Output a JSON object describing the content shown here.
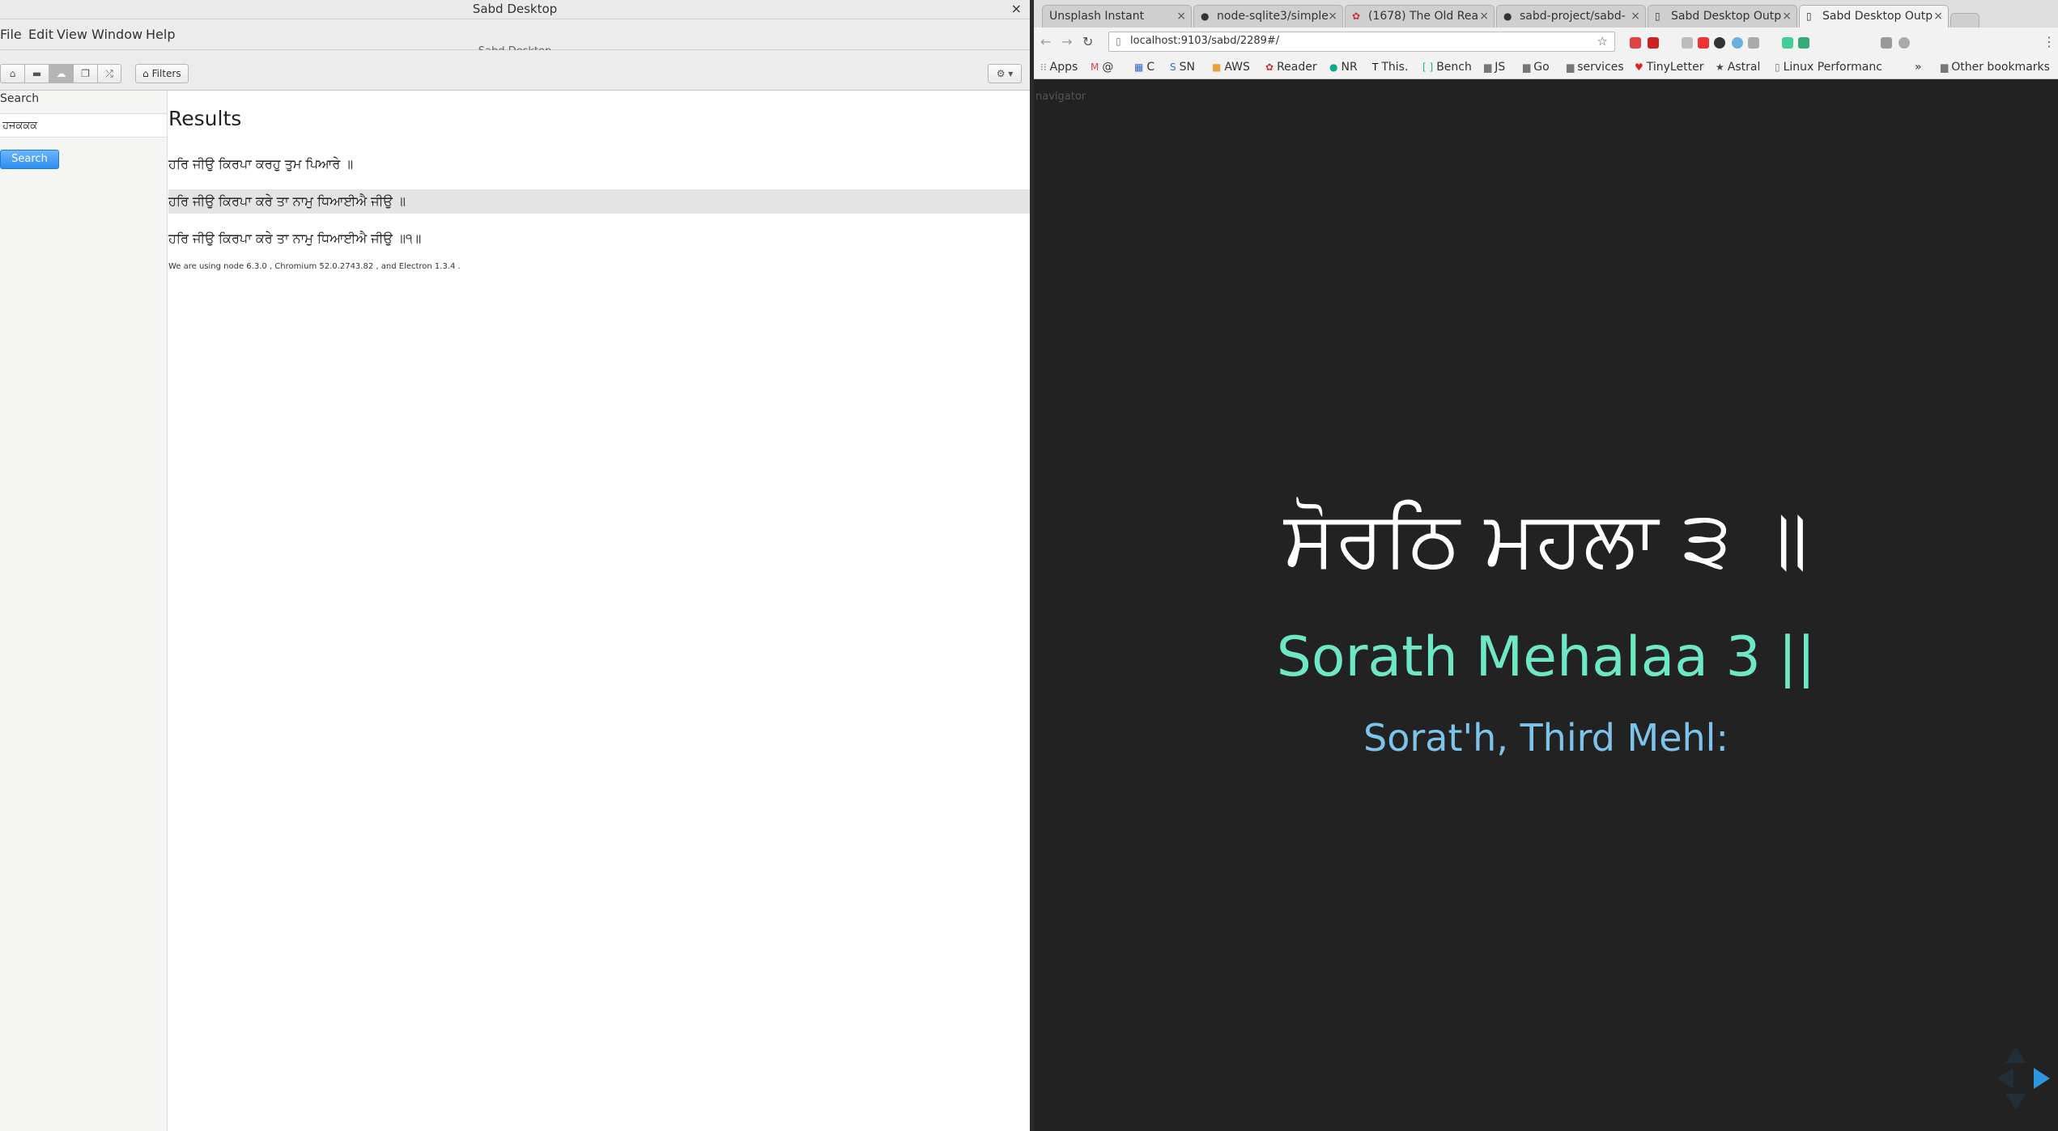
{
  "electron": {
    "title": "Sabd Desktop",
    "close": "×",
    "menu": [
      "File",
      "Edit",
      "View",
      "Window",
      "Help"
    ],
    "subtitle": "Sabd Desktop",
    "toolbar": {
      "filters_label": "Filters",
      "dropdown_label": "⚙ ▾"
    },
    "sidebar": {
      "search_label": "Search",
      "search_value": "ਹਜਕਕਕ",
      "search_button": "Search"
    },
    "results": {
      "heading": "Results",
      "items": [
        "ਹਰਿ ਜੀਉ ਕਿਰਪਾ ਕਰਹੁ ਤੁਮ ਪਿਆਰੇ ॥",
        "ਹਰਿ ਜੀਉ ਕਿਰਪਾ ਕਰੇ ਤਾ ਨਾਮੁ ਧਿਆਈਐ ਜੀਉ ॥",
        "ਹਰਿ ਜੀਉ ਕਿਰਪਾ ਕਰੇ ਤਾ ਨਾਮੁ ਧਿਆਈਐ ਜੀਉ ॥੧॥"
      ],
      "selected_index": 1,
      "footer": "We are using node 6.3.0 , Chromium 52.0.2743.82 , and Electron 1.3.4 ."
    }
  },
  "browser": {
    "tabs": [
      "Unsplash Instant",
      "node-sqlite3/simple",
      "(1678) The Old Rea",
      "sabd-project/sabd-",
      "Sabd Desktop Outp",
      "Sabd Desktop Outp"
    ],
    "active_tab": 5,
    "tab_close": "×",
    "url": "localhost:9103/sabd/2289#/",
    "bookmarks": [
      "Apps",
      "@",
      "C",
      "SN",
      "AWS",
      "Reader",
      "NR",
      "This.",
      "Bench",
      "JS",
      "Go",
      "services",
      "TinyLetter",
      "Astral",
      "Linux Performanc",
      "»",
      "Other bookmarks"
    ],
    "page": {
      "nav_label": "navigator",
      "gurmukhi": "ਸੋਰਠਿ ਮਹਲਾ ੩ ॥",
      "transliteration": "Sorath Mehalaa 3 ||",
      "translation": "Sorat'h, Third Mehl:"
    }
  },
  "colors": {
    "translit": "#6ee7c5",
    "translation": "#7cc4ec",
    "bg": "#222222",
    "accent": "#2c97de"
  }
}
